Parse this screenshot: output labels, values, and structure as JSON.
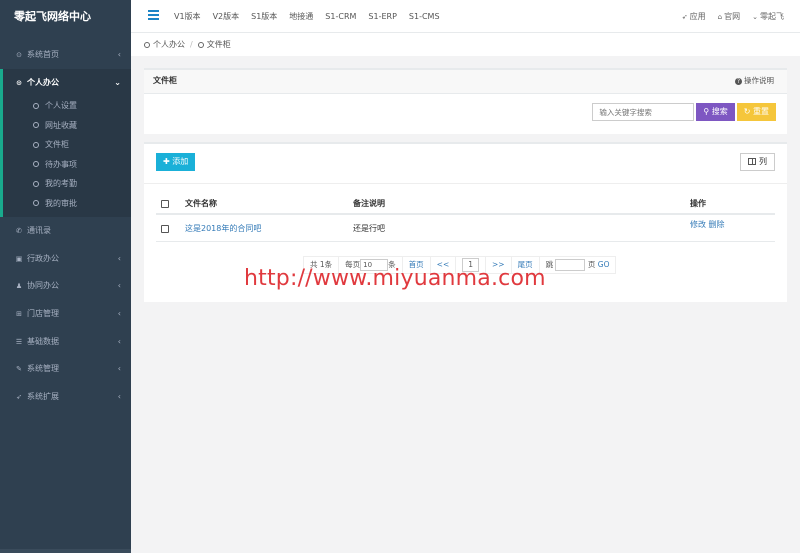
{
  "brand": "零起飞网络中心",
  "sidebar": {
    "items": [
      {
        "label": "系统首页",
        "icon": "dashboard-icon"
      },
      {
        "label": "个人办公",
        "icon": "circle-dot-icon"
      },
      {
        "label": "通讯录",
        "icon": "phone-icon"
      },
      {
        "label": "行政办公",
        "icon": "briefcase-icon"
      },
      {
        "label": "协同办公",
        "icon": "users-icon"
      },
      {
        "label": "门店管理",
        "icon": "sitemap-icon"
      },
      {
        "label": "基础数据",
        "icon": "database-icon"
      },
      {
        "label": "系统管理",
        "icon": "wrench-icon"
      },
      {
        "label": "系统扩展",
        "icon": "rocket-icon"
      }
    ],
    "subitems": [
      "个人设置",
      "网址收藏",
      "文件柜",
      "待办事项",
      "我的考勤",
      "我的审批"
    ]
  },
  "topnav": [
    "V1版本",
    "V2版本",
    "S1版本",
    "地接通",
    "S1-CRM",
    "S1-ERP",
    "S1-CMS"
  ],
  "topright": {
    "app": "应用",
    "home": "官网",
    "user": "零起飞"
  },
  "breadcrumb": [
    "个人办公",
    "文件柜"
  ],
  "search_panel": {
    "title": "文件柜",
    "help": "操作说明",
    "placeholder": "输入关键字搜索",
    "search_label": "搜索",
    "reset_label": "重置"
  },
  "toolbar": {
    "add_label": "添加",
    "columns_label": "列"
  },
  "table": {
    "headers": {
      "name": "文件名称",
      "note": "备注说明",
      "op": "操作"
    },
    "rows": [
      {
        "name": "这是2018年的合同吧",
        "note": "还是行吧",
        "edit": "修改",
        "delete": "删除"
      }
    ]
  },
  "pager": {
    "total": "共 1条",
    "per_page_prefix": "每页",
    "per_page_value": "10",
    "per_page_suffix": "条",
    "first": "首页",
    "prev": "<<",
    "current": "1",
    "next": ">>",
    "last": "尾页",
    "jump_prefix": "跳",
    "jump_suffix": "页",
    "go": "GO"
  },
  "watermark": "http://www.miyuanma.com"
}
